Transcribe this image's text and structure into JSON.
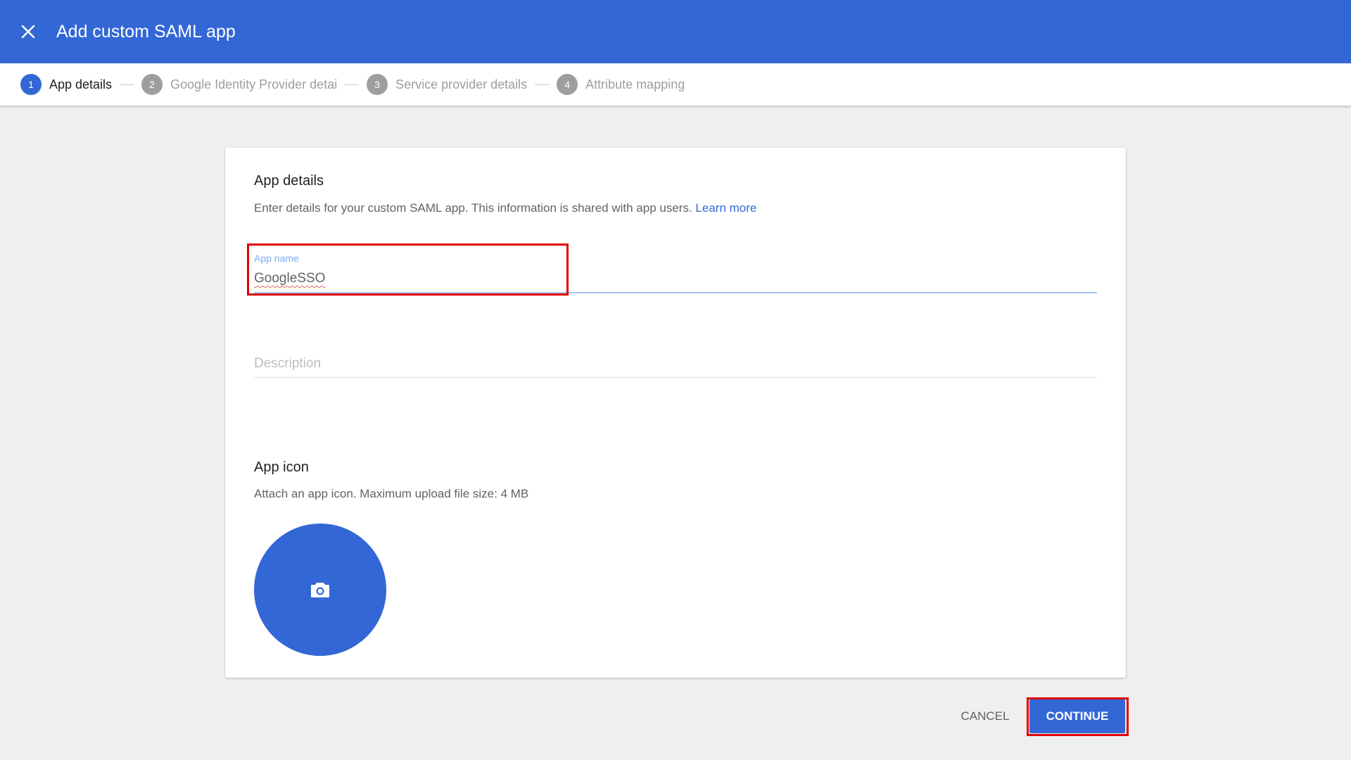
{
  "header": {
    "title": "Add custom SAML app",
    "close_icon": "close-icon"
  },
  "stepper": {
    "steps": [
      {
        "number": "1",
        "label": "App details",
        "active": true
      },
      {
        "number": "2",
        "label": "Google Identity Provider details",
        "active": false
      },
      {
        "number": "3",
        "label": "Service provider details",
        "active": false
      },
      {
        "number": "4",
        "label": "Attribute mapping",
        "active": false
      }
    ]
  },
  "app_details": {
    "title": "App details",
    "description": "Enter details for your custom SAML app. This information is shared with app users.",
    "learn_more": "Learn more",
    "app_name_label": "App name",
    "app_name_value": "GoogleSSO",
    "description_placeholder": "Description"
  },
  "app_icon": {
    "title": "App icon",
    "description": "Attach an app icon. Maximum upload file size: 4 MB",
    "icon": "camera-icon"
  },
  "actions": {
    "cancel_label": "CANCEL",
    "continue_label": "CONTINUE"
  },
  "colors": {
    "primary": "#3367d6",
    "highlight": "#e00000"
  }
}
